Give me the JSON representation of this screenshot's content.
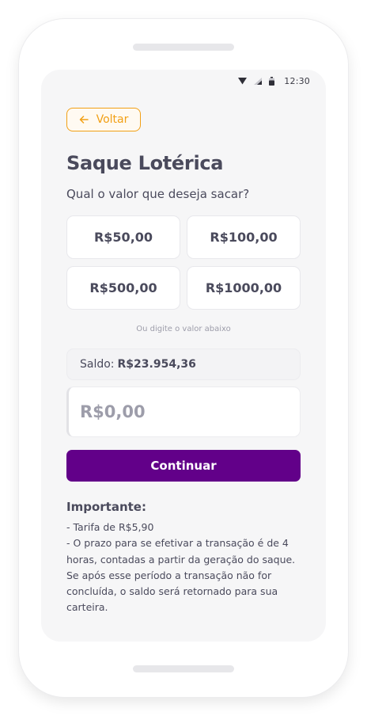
{
  "status_bar": {
    "time": "12:30",
    "icons": [
      "wifi-icon",
      "signal-icon",
      "battery-icon"
    ]
  },
  "header": {
    "back_label": "Voltar",
    "back_icon": "arrow-left-icon"
  },
  "page": {
    "title": "Saque Lotérica",
    "subtitle": "Qual o valor que deseja sacar?"
  },
  "amount_options": [
    {
      "label": "R$50,00"
    },
    {
      "label": "R$100,00"
    },
    {
      "label": "R$500,00"
    },
    {
      "label": "R$1000,00"
    }
  ],
  "hint": "Ou digite o valor abaixo",
  "balance": {
    "label": "Saldo:",
    "value": "R$23.954,36"
  },
  "amount_input": {
    "value": "",
    "placeholder": "R$0,00"
  },
  "continue_label": "Continuar",
  "important": {
    "heading": "Importante:",
    "lines": [
      "- Tarifa de R$5,90",
      "- O prazo para se efetivar a transação é de 4",
      "horas, contadas a partir da geração do saque.",
      "Se após esse período a transação não for",
      "concluída, o saldo será retornado para sua",
      "carteira."
    ]
  },
  "colors": {
    "primary": "#620089",
    "accent": "#f2a015",
    "text": "#4a4a5c",
    "muted": "#9d9daa",
    "screen_background": "#f6f6f7"
  }
}
